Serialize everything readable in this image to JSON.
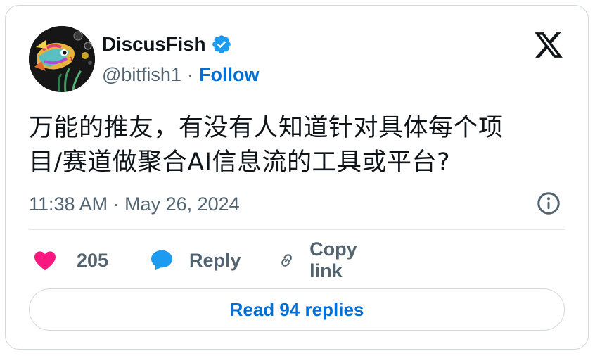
{
  "author": {
    "display_name": "DiscusFish",
    "handle": "@bitfish1",
    "separator": "·",
    "follow_label": "Follow",
    "verified": true
  },
  "tweet": {
    "text_lines": [
      "万能的推友，有没有人知道针对具体每个项",
      "目/赛道做聚合AI信息流的工具或平台?"
    ],
    "timestamp": "11:38 AM · May 26, 2024"
  },
  "actions": {
    "like_count": "205",
    "reply_label": "Reply",
    "copy_link_label": "Copy link"
  },
  "read_replies_label": "Read 94 replies",
  "colors": {
    "accent": "#1d9bf0",
    "link_blue": "#006fd6",
    "like_pink": "#f91880",
    "muted": "#536471",
    "text": "#0f1419",
    "border": "#cfd9de"
  },
  "icons": {
    "verified": "verified-badge-icon",
    "platform": "x-logo-icon",
    "info": "info-icon",
    "like": "heart-icon",
    "reply": "speech-bubble-icon",
    "copy": "link-icon"
  }
}
